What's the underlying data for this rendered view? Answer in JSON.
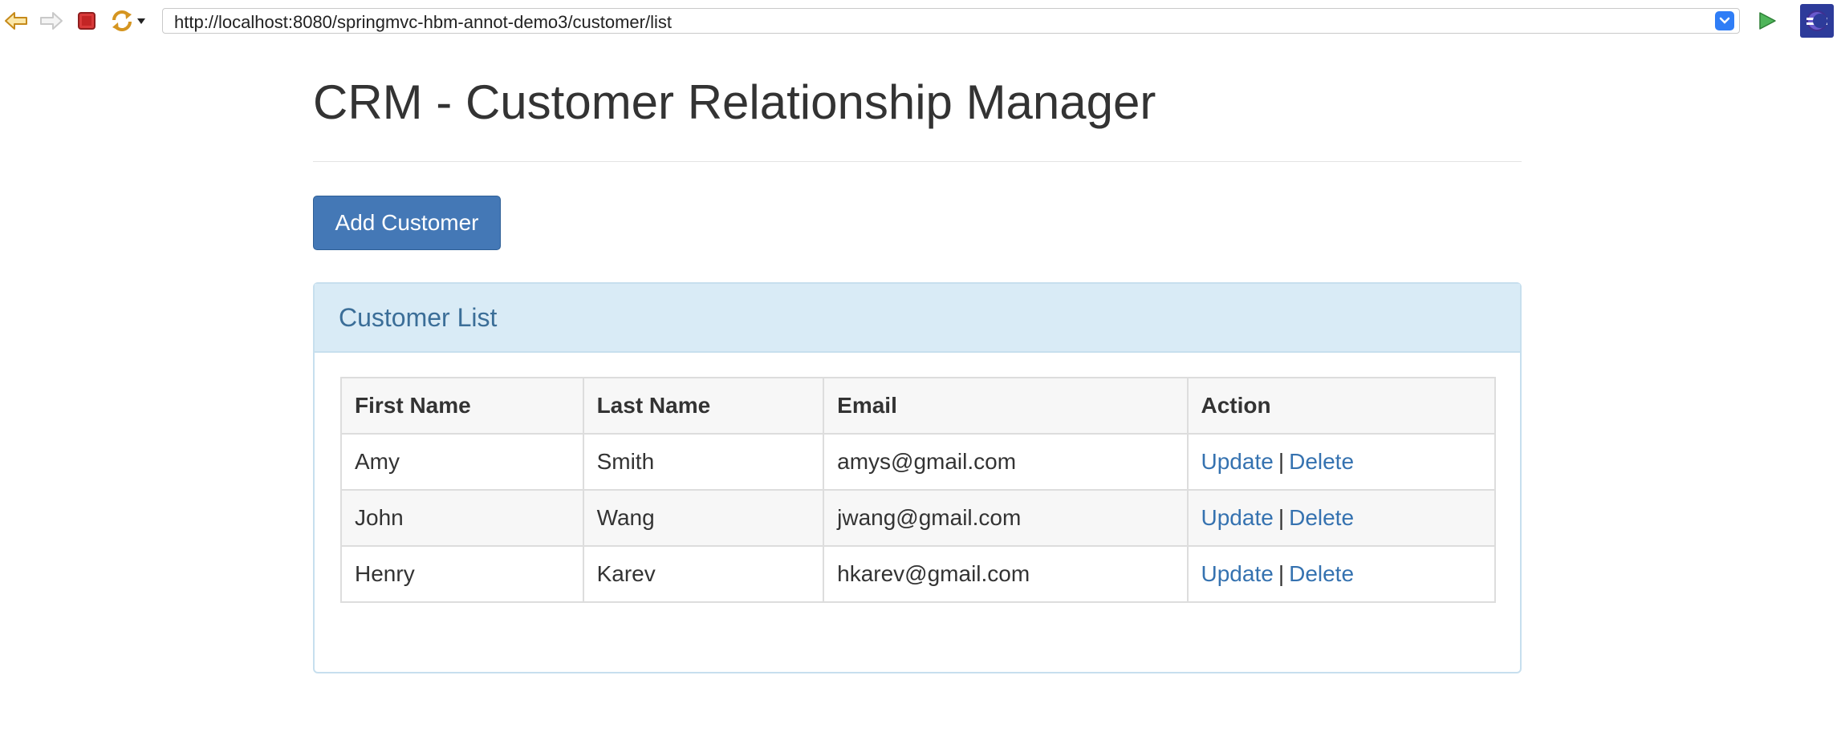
{
  "browser": {
    "url": "http://localhost:8080/springmvc-hbm-annot-demo3/customer/list",
    "icons": [
      "back-arrow-icon",
      "forward-arrow-icon",
      "stop-icon",
      "refresh-icon",
      "chevron-down-icon",
      "go-icon",
      "eclipse-logo-icon"
    ]
  },
  "page": {
    "title": "CRM - Customer Relationship Manager",
    "add_button_label": "Add Customer"
  },
  "panel": {
    "title": "Customer List",
    "columns": [
      "First Name",
      "Last Name",
      "Email",
      "Action"
    ],
    "rows": [
      {
        "first_name": "Amy",
        "last_name": "Smith",
        "email": "amys@gmail.com",
        "update": "Update",
        "delete": "Delete"
      },
      {
        "first_name": "John",
        "last_name": "Wang",
        "email": "jwang@gmail.com",
        "update": "Update",
        "delete": "Delete"
      },
      {
        "first_name": "Henry",
        "last_name": "Karev",
        "email": "hkarev@gmail.com",
        "update": "Update",
        "delete": "Delete"
      }
    ],
    "action_separator": "|"
  },
  "colors": {
    "button": "#4478b6",
    "panel_heading": "#d9ebf6",
    "link": "#3572b0"
  }
}
